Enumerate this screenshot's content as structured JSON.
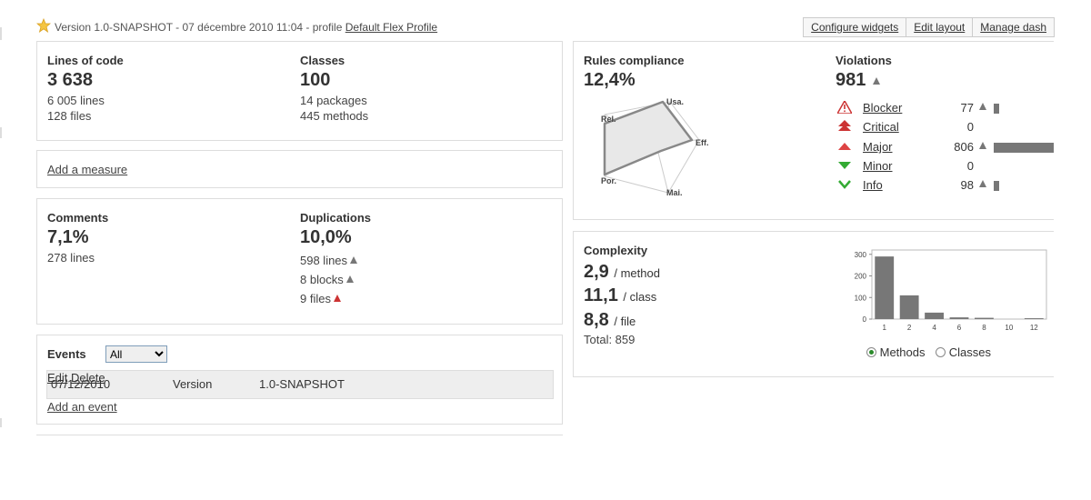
{
  "header": {
    "version_text": "Version 1.0-SNAPSHOT - 07 décembre 2010 11:04 - profile",
    "profile_link": "Default Flex Profile",
    "toolbar": [
      "Configure widgets",
      "Edit layout",
      "Manage dash"
    ]
  },
  "size": {
    "loc_label": "Lines of code",
    "loc_value": "3 638",
    "lines": "6 005 lines",
    "files": "128 files",
    "classes_label": "Classes",
    "classes_value": "100",
    "packages": "14 packages",
    "methods": "445 methods"
  },
  "add_measure": "Add a measure",
  "comments": {
    "label": "Comments",
    "value": "7,1%",
    "lines": "278 lines",
    "dup_label": "Duplications",
    "dup_value": "10,0%",
    "dup_lines": "598 lines",
    "dup_blocks": "8 blocks",
    "dup_files": "9 files"
  },
  "events": {
    "label": "Events",
    "filter_selected": "All",
    "rows": [
      {
        "date": "07/12/2010",
        "category": "Version",
        "name": "1.0-SNAPSHOT",
        "edit": "Edit",
        "delete": "Delete"
      }
    ],
    "add_event": "Add an event"
  },
  "rules": {
    "label": "Rules compliance",
    "value": "12,4%",
    "radar_labels": [
      "Usa.",
      "Eff.",
      "Mai.",
      "Por.",
      "Rel."
    ]
  },
  "violations": {
    "label": "Violations",
    "value": "981",
    "items": [
      {
        "name": "Blocker",
        "count": "77",
        "trend": true,
        "bar": 0.08
      },
      {
        "name": "Critical",
        "count": "0",
        "trend": false,
        "bar": 0
      },
      {
        "name": "Major",
        "count": "806",
        "trend": true,
        "bar": 1.0
      },
      {
        "name": "Minor",
        "count": "0",
        "trend": false,
        "bar": 0
      },
      {
        "name": "Info",
        "count": "98",
        "trend": true,
        "bar": 0.1
      }
    ]
  },
  "complexity": {
    "label": "Complexity",
    "per_method": "2,9",
    "per_method_unit": "/ method",
    "per_class": "11,1",
    "per_class_unit": "/ class",
    "per_file": "8,8",
    "per_file_unit": "/ file",
    "total": "Total: 859",
    "radio_methods": "Methods",
    "radio_classes": "Classes",
    "selected": "Methods"
  },
  "chart_data": {
    "type": "bar",
    "categories": [
      "1",
      "2",
      "4",
      "6",
      "8",
      "10",
      "12"
    ],
    "values": [
      290,
      110,
      30,
      8,
      6,
      0,
      4
    ],
    "ylim": [
      0,
      320
    ],
    "yticks": [
      "300",
      "200",
      "100",
      "0"
    ],
    "color": "#777777"
  }
}
